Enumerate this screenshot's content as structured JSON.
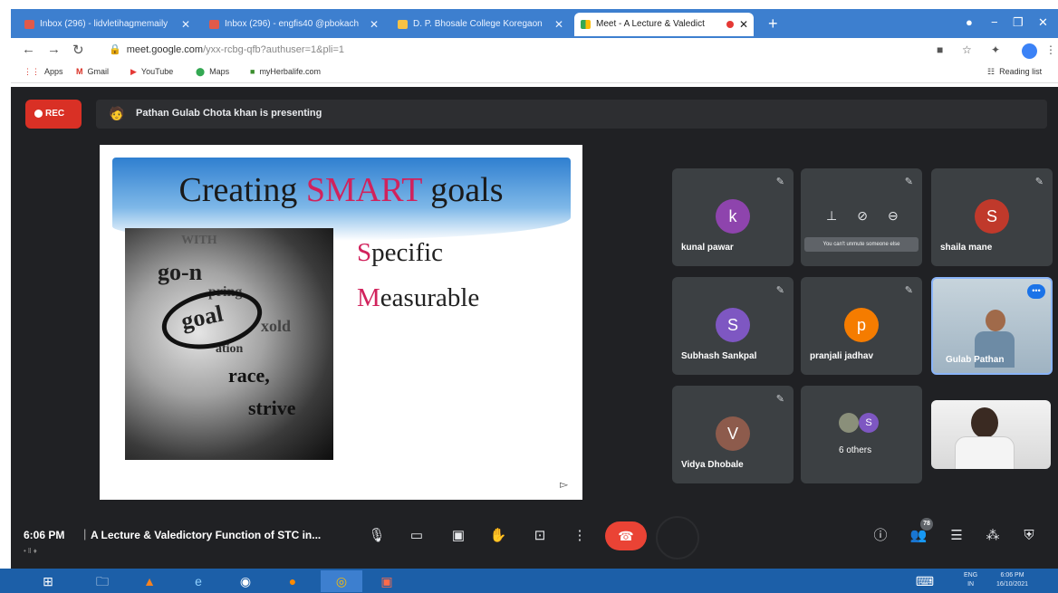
{
  "browser": {
    "tabs": [
      {
        "label": "Inbox (296) - lidvletihagmemaily",
        "active": false
      },
      {
        "label": "Inbox (296) - engfis40 @pbokach",
        "active": false
      },
      {
        "label": "D. P. Bhosale College Koregaon",
        "active": false
      },
      {
        "label": "Meet - A Lecture & Valedict",
        "active": true
      }
    ],
    "url_host": "meet.google.com",
    "url_path": "/yxx-rcbg-qfb?authuser=1&pli=1",
    "bookmarks": [
      "Apps",
      "Gmail",
      "YouTube",
      "Maps",
      "myHerbalife.com"
    ],
    "reading_list": "Reading list"
  },
  "meet": {
    "rec_label": "REC",
    "presenting_text": "Pathan Gulab Chota khan is presenting",
    "slide": {
      "title_before": "Creating ",
      "title_highlight": "SMART",
      "title_after": " goals",
      "image_words": [
        "WITH",
        "go-n",
        "pring",
        "goal",
        "race,",
        "strive",
        "xold",
        "ation"
      ],
      "bullets": [
        {
          "cap": "S",
          "rest": "pecific"
        },
        {
          "cap": "M",
          "rest": "easurable"
        }
      ]
    },
    "participants": [
      {
        "name": "kunal pawar",
        "initial": "k",
        "color": "#8e44ad"
      },
      {
        "name": "",
        "initial": "",
        "color": "",
        "tooltip": "You can't unmute someone else"
      },
      {
        "name": "shaila mane",
        "initial": "S",
        "color": "#c0392b"
      },
      {
        "name": "Subhash Sankpal",
        "initial": "S",
        "color": "#7e57c2"
      },
      {
        "name": "pranjali jadhav",
        "initial": "p",
        "color": "#f57c00"
      },
      {
        "name": "Gulab Pathan",
        "initial": "",
        "color": ""
      },
      {
        "name": "Vidya Dhobale",
        "initial": "V",
        "color": "#8d5b4c"
      },
      {
        "name": "6 others",
        "initial": "S",
        "color": "#7e57c2"
      },
      {
        "name": "",
        "initial": "",
        "color": ""
      }
    ],
    "time": "6:06 PM",
    "separator": "|",
    "meeting_title": "A Lecture & Valedictory Function of STC in...",
    "subtext": "• ll ♦",
    "participant_count": "78"
  },
  "taskbar": {
    "lang": "ENG",
    "lang2": "IN",
    "clock_time": "6:06 PM",
    "clock_date": "16/10/2021"
  }
}
